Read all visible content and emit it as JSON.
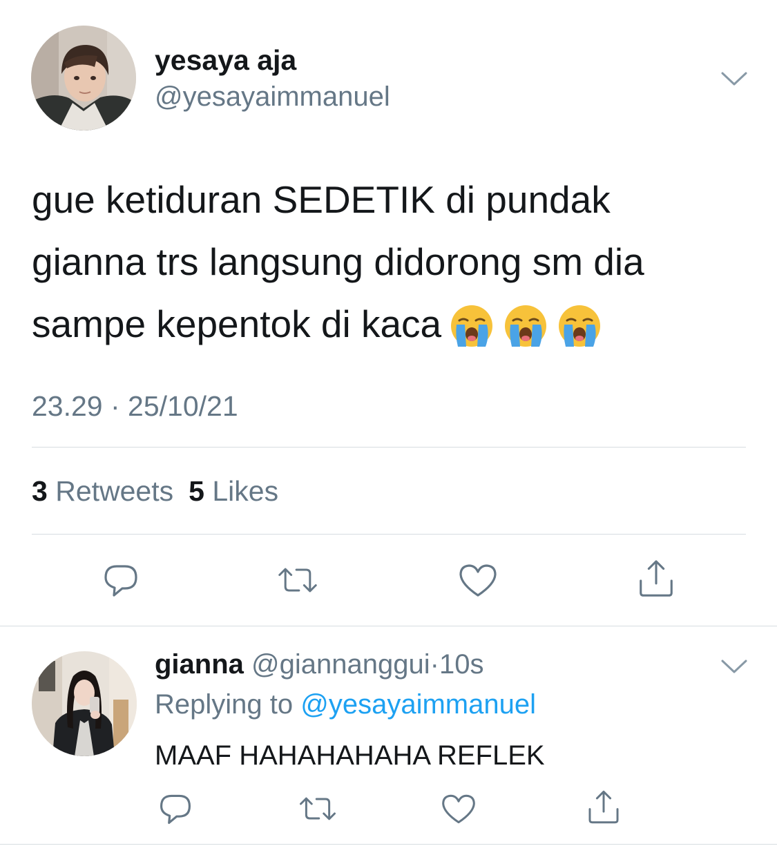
{
  "tweet": {
    "author_name": "yesaya aja",
    "author_handle": "@yesayaimmanuel",
    "text_lines": [
      "gue ketiduran SEDETIK di pundak",
      "gianna trs langsung didorong sm dia",
      "sampe kepentok di kaca"
    ],
    "emojis": [
      "loudly-crying-face",
      "loudly-crying-face",
      "loudly-crying-face"
    ],
    "timestamp": "23.29 · 25/10/21",
    "retweets_count": "3",
    "retweets_label": "Retweets",
    "likes_count": "5",
    "likes_label": "Likes",
    "actions": [
      "reply-icon",
      "retweet-icon",
      "like-icon",
      "share-icon"
    ]
  },
  "reply": {
    "author_name": "gianna",
    "author_handle": "@giannanggui",
    "separator": "·",
    "time_ago": "10s",
    "replying_prefix": "Replying to",
    "replying_to": "@yesayaimmanuel",
    "text": "MAAF HAHAHAHAHA REFLEK",
    "actions": [
      "reply-icon",
      "retweet-icon",
      "like-icon",
      "share-icon"
    ]
  },
  "colors": {
    "text_primary": "#14171a",
    "text_secondary": "#657786",
    "link": "#1da1f2",
    "divider": "#d6dce0",
    "icon": "#657786"
  }
}
